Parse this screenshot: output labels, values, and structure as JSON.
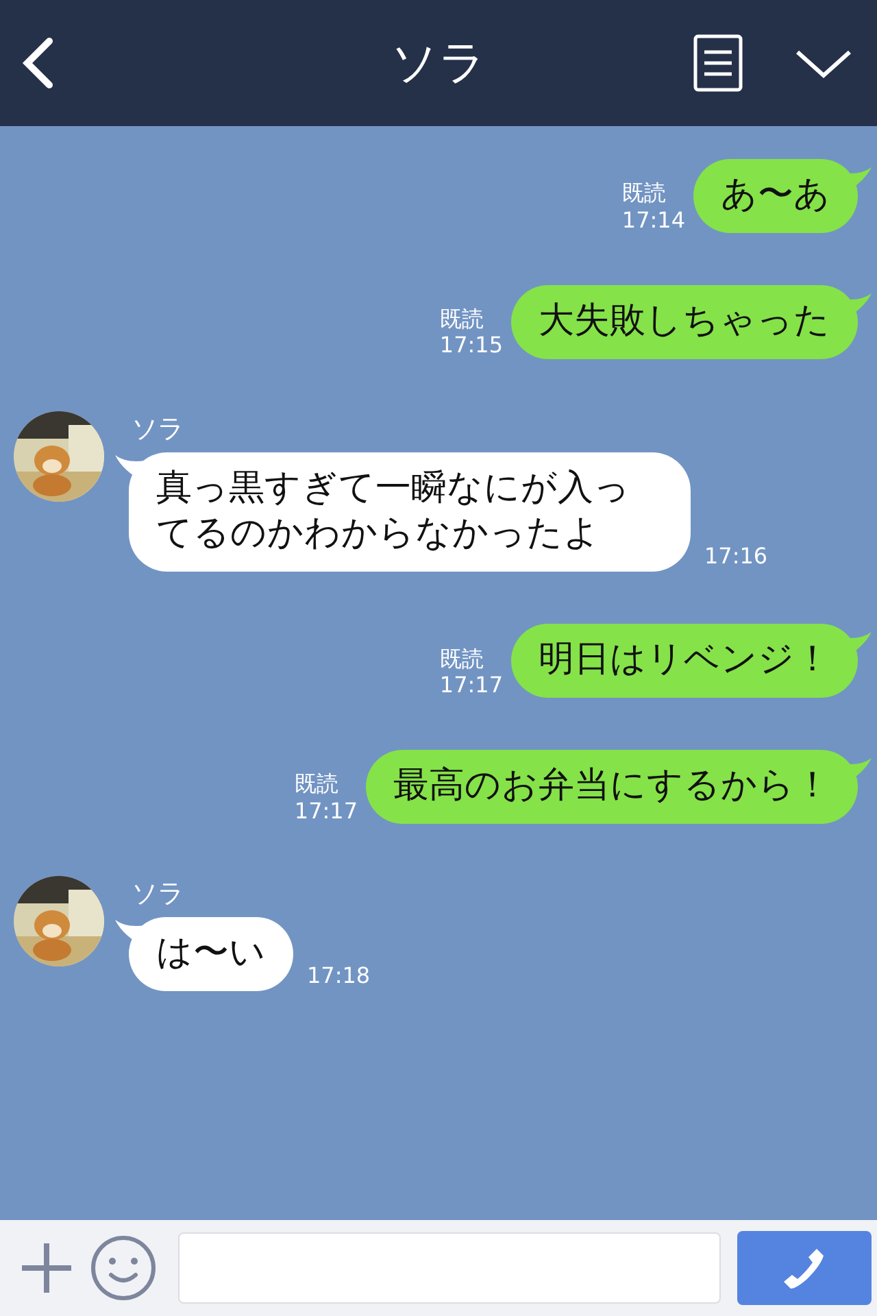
{
  "header": {
    "title": "ソラ"
  },
  "messages": [
    {
      "kind": "sent",
      "text": "あ〜あ",
      "read": "既読",
      "time": "17:14"
    },
    {
      "kind": "sent",
      "text": "大失敗しちゃった",
      "read": "既読",
      "time": "17:15"
    },
    {
      "kind": "received",
      "sender": "ソラ",
      "text": "真っ黒すぎて一瞬なにが入ってるのかわからなかったよ",
      "time": "17:16"
    },
    {
      "kind": "sent",
      "text": "明日はリベンジ！",
      "read": "既読",
      "time": "17:17"
    },
    {
      "kind": "sent",
      "text": "最高のお弁当にするから！",
      "read": "既読",
      "time": "17:17"
    },
    {
      "kind": "received",
      "sender": "ソラ",
      "text": "は〜い",
      "time": "17:18"
    }
  ]
}
